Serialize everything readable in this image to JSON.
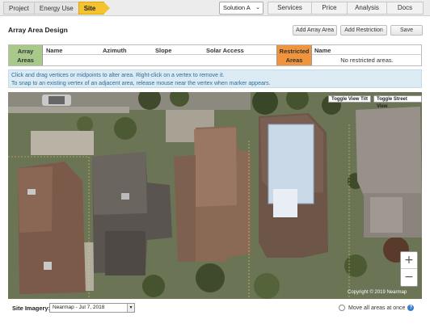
{
  "nav": {
    "left_tabs": [
      "Project",
      "Energy Use",
      "Site"
    ],
    "solution": "Solution A",
    "right_tabs": [
      "Services",
      "Price",
      "Analysis",
      "Docs"
    ]
  },
  "header": {
    "title": "Array Area Design",
    "add_array_area": "Add Array Area",
    "add_restriction": "Add Restriction",
    "save": "Save"
  },
  "array_table": {
    "label_line1": "Array",
    "label_line2": "Areas",
    "columns": [
      "Name",
      "Azimuth",
      "Slope",
      "Solar Access"
    ]
  },
  "restricted_table": {
    "label_line1": "Restricted",
    "label_line2": "Areas",
    "column": "Name",
    "empty_text": "No restricted areas."
  },
  "info": {
    "line1": "Click and drag vertices or midpoints to alter area. Right-click on a vertex to remove it.",
    "line2": "To snap to an existing vertex of an adjacent area, release mouse near the vertex when marker appears."
  },
  "map": {
    "toggle_tilt": "Toggle View Tilt",
    "toggle_street": "Toggle Street View",
    "zoom_in": "+",
    "zoom_out": "−",
    "copyright": "Copyright © 2019 Nearmap"
  },
  "footer": {
    "imagery_label": "Site Imagery:",
    "imagery_value": "Nearmap - Jul 7, 2018",
    "move_all": "Move all areas at once",
    "help_icon": "?"
  },
  "colors": {
    "active_tab": "#f4c430",
    "array_header": "#a9c98b",
    "restricted_header": "#f0953d",
    "info_bg": "#dceaf3",
    "info_text": "#2b6f9c"
  }
}
